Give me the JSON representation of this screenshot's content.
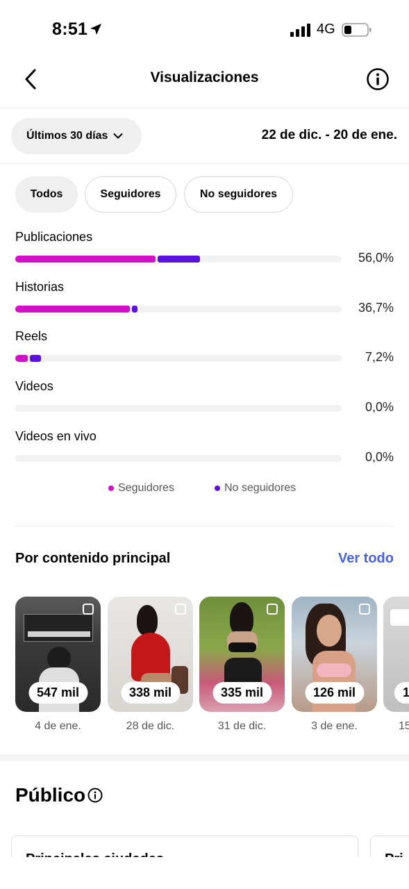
{
  "status": {
    "time": "8:51",
    "network": "4G"
  },
  "nav": {
    "title": "Visualizaciones"
  },
  "period": {
    "label": "Últimos 30 días",
    "range": "22 de dic. - 20 de ene."
  },
  "filters": [
    {
      "label": "Todos",
      "active": true
    },
    {
      "label": "Seguidores",
      "active": false
    },
    {
      "label": "No seguidores",
      "active": false
    }
  ],
  "breakdown": [
    {
      "label": "Publicaciones",
      "pct": "56,0%",
      "followers_share": 0.43,
      "non_followers_share": 0.13
    },
    {
      "label": "Historias",
      "pct": "36,7%",
      "followers_share": 0.35,
      "non_followers_share": 0.017
    },
    {
      "label": "Reels",
      "pct": "7,2%",
      "followers_share": 0.038,
      "non_followers_share": 0.034
    },
    {
      "label": "Videos",
      "pct": "0,0%",
      "followers_share": 0,
      "non_followers_share": 0
    },
    {
      "label": "Videos en vivo",
      "pct": "0,0%",
      "followers_share": 0,
      "non_followers_share": 0
    }
  ],
  "legend": {
    "followers": "Seguidores",
    "non_followers": "No seguidores",
    "followers_color": "#d40fc8",
    "non_followers_color": "#5b12df"
  },
  "top_content": {
    "title": "Por contenido principal",
    "see_all": "Ver todo",
    "items": [
      {
        "views": "547 mil",
        "date": "4 de ene."
      },
      {
        "views": "338 mil",
        "date": "28 de dic."
      },
      {
        "views": "335 mil",
        "date": "31 de dic."
      },
      {
        "views": "126 mil",
        "date": "3 de ene."
      },
      {
        "views": "1",
        "date": "15"
      }
    ]
  },
  "audience": {
    "title": "Público",
    "card_title": "Principales ciudades",
    "card2_title": "Pri"
  }
}
